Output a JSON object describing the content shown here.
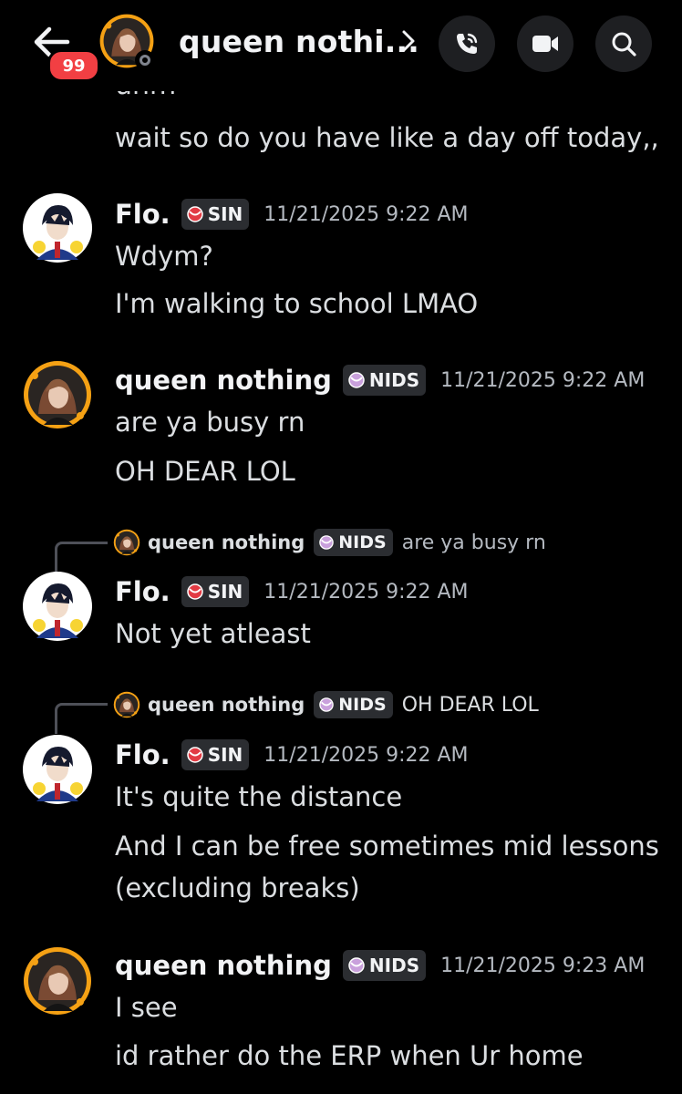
{
  "header": {
    "title": "queen nothi...",
    "unread_count": "99",
    "icons": {
      "back": "back-arrow-icon",
      "call": "phone-call-icon",
      "video": "video-camera-icon",
      "search": "search-icon",
      "chevron": "chevron-right-icon"
    }
  },
  "colors": {
    "background": "#000000",
    "badge": "#f23f43",
    "text": "#dbdee1",
    "muted": "#b5bac1",
    "tag_bg": "#2b2d31",
    "avatar_ring": "#f5a114"
  },
  "messages": {
    "clipped_top_text": "uhm",
    "first_line": "wait so do you have like a day off today,,",
    "m1": {
      "username": "Flo.",
      "tag": "SIN",
      "timestamp": "11/21/2025 9:22 AM",
      "lines": [
        "Wdym?",
        "I'm walking to school LMAO"
      ]
    },
    "m2": {
      "username": "queen nothing",
      "tag": "NIDS",
      "timestamp": "11/21/2025 9:22 AM",
      "lines": [
        "are ya busy rn",
        "OH DEAR LOL"
      ]
    },
    "m3": {
      "reply": {
        "username": "queen nothing",
        "tag": "NIDS",
        "text": "are ya busy rn"
      },
      "username": "Flo.",
      "tag": "SIN",
      "timestamp": "11/21/2025 9:22 AM",
      "lines": [
        "Not yet atleast"
      ]
    },
    "m4": {
      "reply": {
        "username": "queen nothing",
        "tag": "NIDS",
        "text": "OH DEAR LOL"
      },
      "username": "Flo.",
      "tag": "SIN",
      "timestamp": "11/21/2025 9:22 AM",
      "lines": [
        "It's quite the distance",
        "And I can be free sometimes mid lessons",
        "(excluding breaks)"
      ]
    },
    "m5": {
      "username": "queen nothing",
      "tag": "NIDS",
      "timestamp": "11/21/2025 9:23 AM",
      "lines": [
        "I see",
        "id rather do the ERP when Ur home"
      ]
    }
  }
}
